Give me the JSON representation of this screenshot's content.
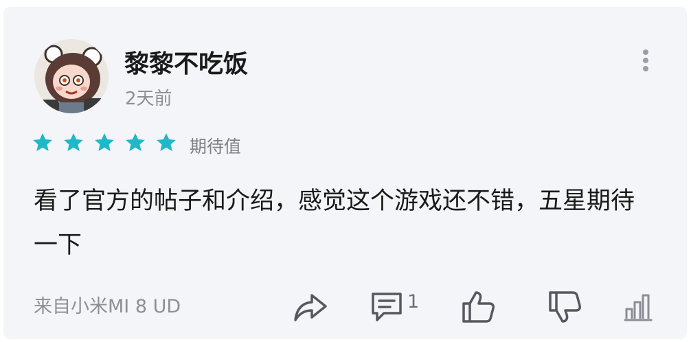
{
  "user": {
    "name": "黎黎不吃饭",
    "time": "2天前"
  },
  "rating": {
    "stars": 5,
    "max": 5,
    "label": "期待值",
    "color": "#1fb8c8"
  },
  "review": {
    "text": "看了官方的帖子和介绍，感觉这个游戏还不错，五星期待一下"
  },
  "footer": {
    "device": "来自小米MI 8 UD",
    "comment_count": "1"
  },
  "icons": {
    "avatar": "anime-avatar",
    "more": "more-vertical-icon",
    "share": "share-icon",
    "comment": "comment-icon",
    "like": "thumbs-up-icon",
    "dislike": "thumbs-down-icon",
    "stats": "stats-icon"
  }
}
